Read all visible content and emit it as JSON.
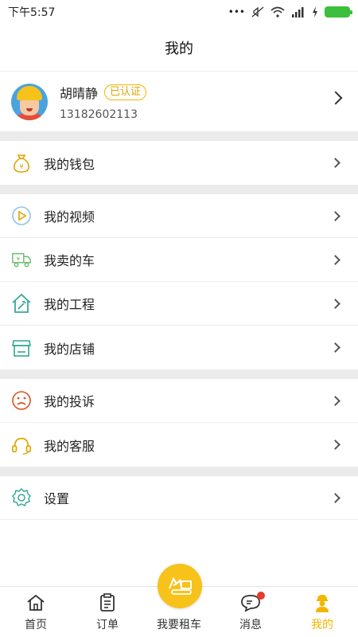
{
  "status_bar": {
    "time": "下午5:57",
    "dots": "•••"
  },
  "header": {
    "title": "我的"
  },
  "profile": {
    "name": "胡晴静",
    "badge": "已认证",
    "phone": "13182602113"
  },
  "menu_groups": [
    [
      {
        "label": "我的钱包",
        "icon": "wallet-icon"
      }
    ],
    [
      {
        "label": "我的视频",
        "icon": "video-icon"
      },
      {
        "label": "我卖的车",
        "icon": "truck-icon"
      },
      {
        "label": "我的工程",
        "icon": "project-icon"
      },
      {
        "label": "我的店铺",
        "icon": "store-icon"
      }
    ],
    [
      {
        "label": "我的投诉",
        "icon": "complaint-icon"
      },
      {
        "label": "我的客服",
        "icon": "headset-icon"
      }
    ],
    [
      {
        "label": "设置",
        "icon": "settings-icon"
      }
    ]
  ],
  "tab_bar": [
    {
      "label": "首页",
      "icon": "home-icon"
    },
    {
      "label": "订单",
      "icon": "order-icon"
    },
    {
      "label": "我要租车",
      "icon": "excavator-icon"
    },
    {
      "label": "消息",
      "icon": "message-icon"
    },
    {
      "label": "我的",
      "icon": "worker-icon",
      "active": true
    }
  ],
  "colors": {
    "accent": "#f2b600",
    "separator": "#ebebeb",
    "badge_dot": "#e8392b"
  }
}
